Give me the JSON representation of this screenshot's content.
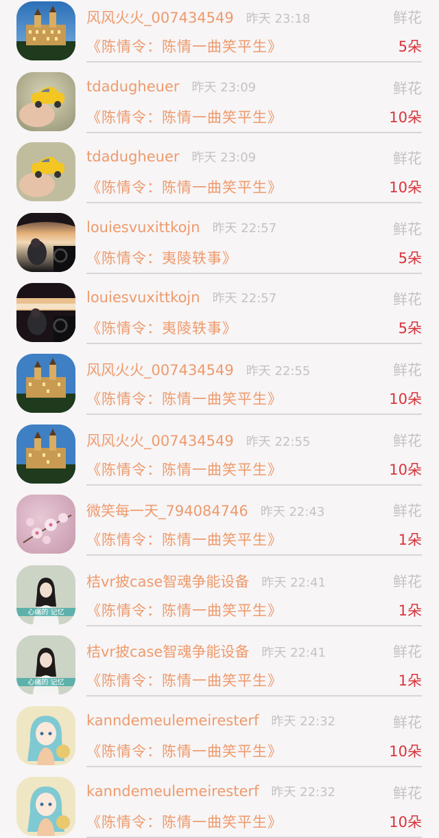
{
  "gift_label": "鲜花",
  "colors": {
    "username": "#ee9a6c",
    "time": "#c4c2c3",
    "count": "#d8343c",
    "divider": "#d8d5d6",
    "background": "#f7f5f6"
  },
  "rows": [
    {
      "avatar": "castle-avatar-icon",
      "user": "风风火火_007434549",
      "time": "昨天 23:18",
      "drama": "《陈情令：陈情一曲笑平生》",
      "count": "5朵"
    },
    {
      "avatar": "yellow-car-avatar-icon",
      "user": "tdadugheuer",
      "time": "昨天 23:09",
      "drama": "《陈情令：陈情一曲笑平生》",
      "count": "10朵"
    },
    {
      "avatar": "yellow-car-avatar-icon",
      "user": "tdadugheuer",
      "time": "昨天 23:09",
      "drama": "《陈情令：陈情一曲笑平生》",
      "count": "10朵"
    },
    {
      "avatar": "driving-sunset-avatar-icon",
      "user": "louiesvuxittkojn",
      "time": "昨天 22:57",
      "drama": "《陈情令：夷陵轶事》",
      "count": "5朵"
    },
    {
      "avatar": "driving-sunset-avatar-icon",
      "user": "louiesvuxittkojn",
      "time": "昨天 22:57",
      "drama": "《陈情令：夷陵轶事》",
      "count": "5朵"
    },
    {
      "avatar": "castle-avatar-icon",
      "user": "风风火火_007434549",
      "time": "昨天 22:55",
      "drama": "《陈情令：陈情一曲笑平生》",
      "count": "10朵"
    },
    {
      "avatar": "castle-avatar-icon",
      "user": "风风火火_007434549",
      "time": "昨天 22:55",
      "drama": "《陈情令：陈情一曲笑平生》",
      "count": "10朵"
    },
    {
      "avatar": "cherry-blossom-avatar-icon",
      "user": "微笑每一天_794084746",
      "time": "昨天 22:43",
      "drama": "《陈情令：陈情一曲笑平生》",
      "count": "1朵"
    },
    {
      "avatar": "girl-portrait-avatar-icon",
      "avatar_caption": "心痛的 记忆",
      "user": "桔vr披case智魂争能设备",
      "time": "昨天 22:41",
      "drama": "《陈情令：陈情一曲笑平生》",
      "count": "1朵"
    },
    {
      "avatar": "girl-portrait-avatar-icon",
      "avatar_caption": "心痛的 记忆",
      "user": "桔vr披case智魂争能设备",
      "time": "昨天 22:41",
      "drama": "《陈情令：陈情一曲笑平生》",
      "count": "1朵"
    },
    {
      "avatar": "anime-girl-avatar-icon",
      "user": "kanndemeulemeiresterf",
      "time": "昨天 22:32",
      "drama": "《陈情令：陈情一曲笑平生》",
      "count": "10朵"
    },
    {
      "avatar": "anime-girl-avatar-icon",
      "user": "kanndemeulemeiresterf",
      "time": "昨天 22:32",
      "drama": "《陈情令：陈情一曲笑平生》",
      "count": "10朵"
    }
  ]
}
